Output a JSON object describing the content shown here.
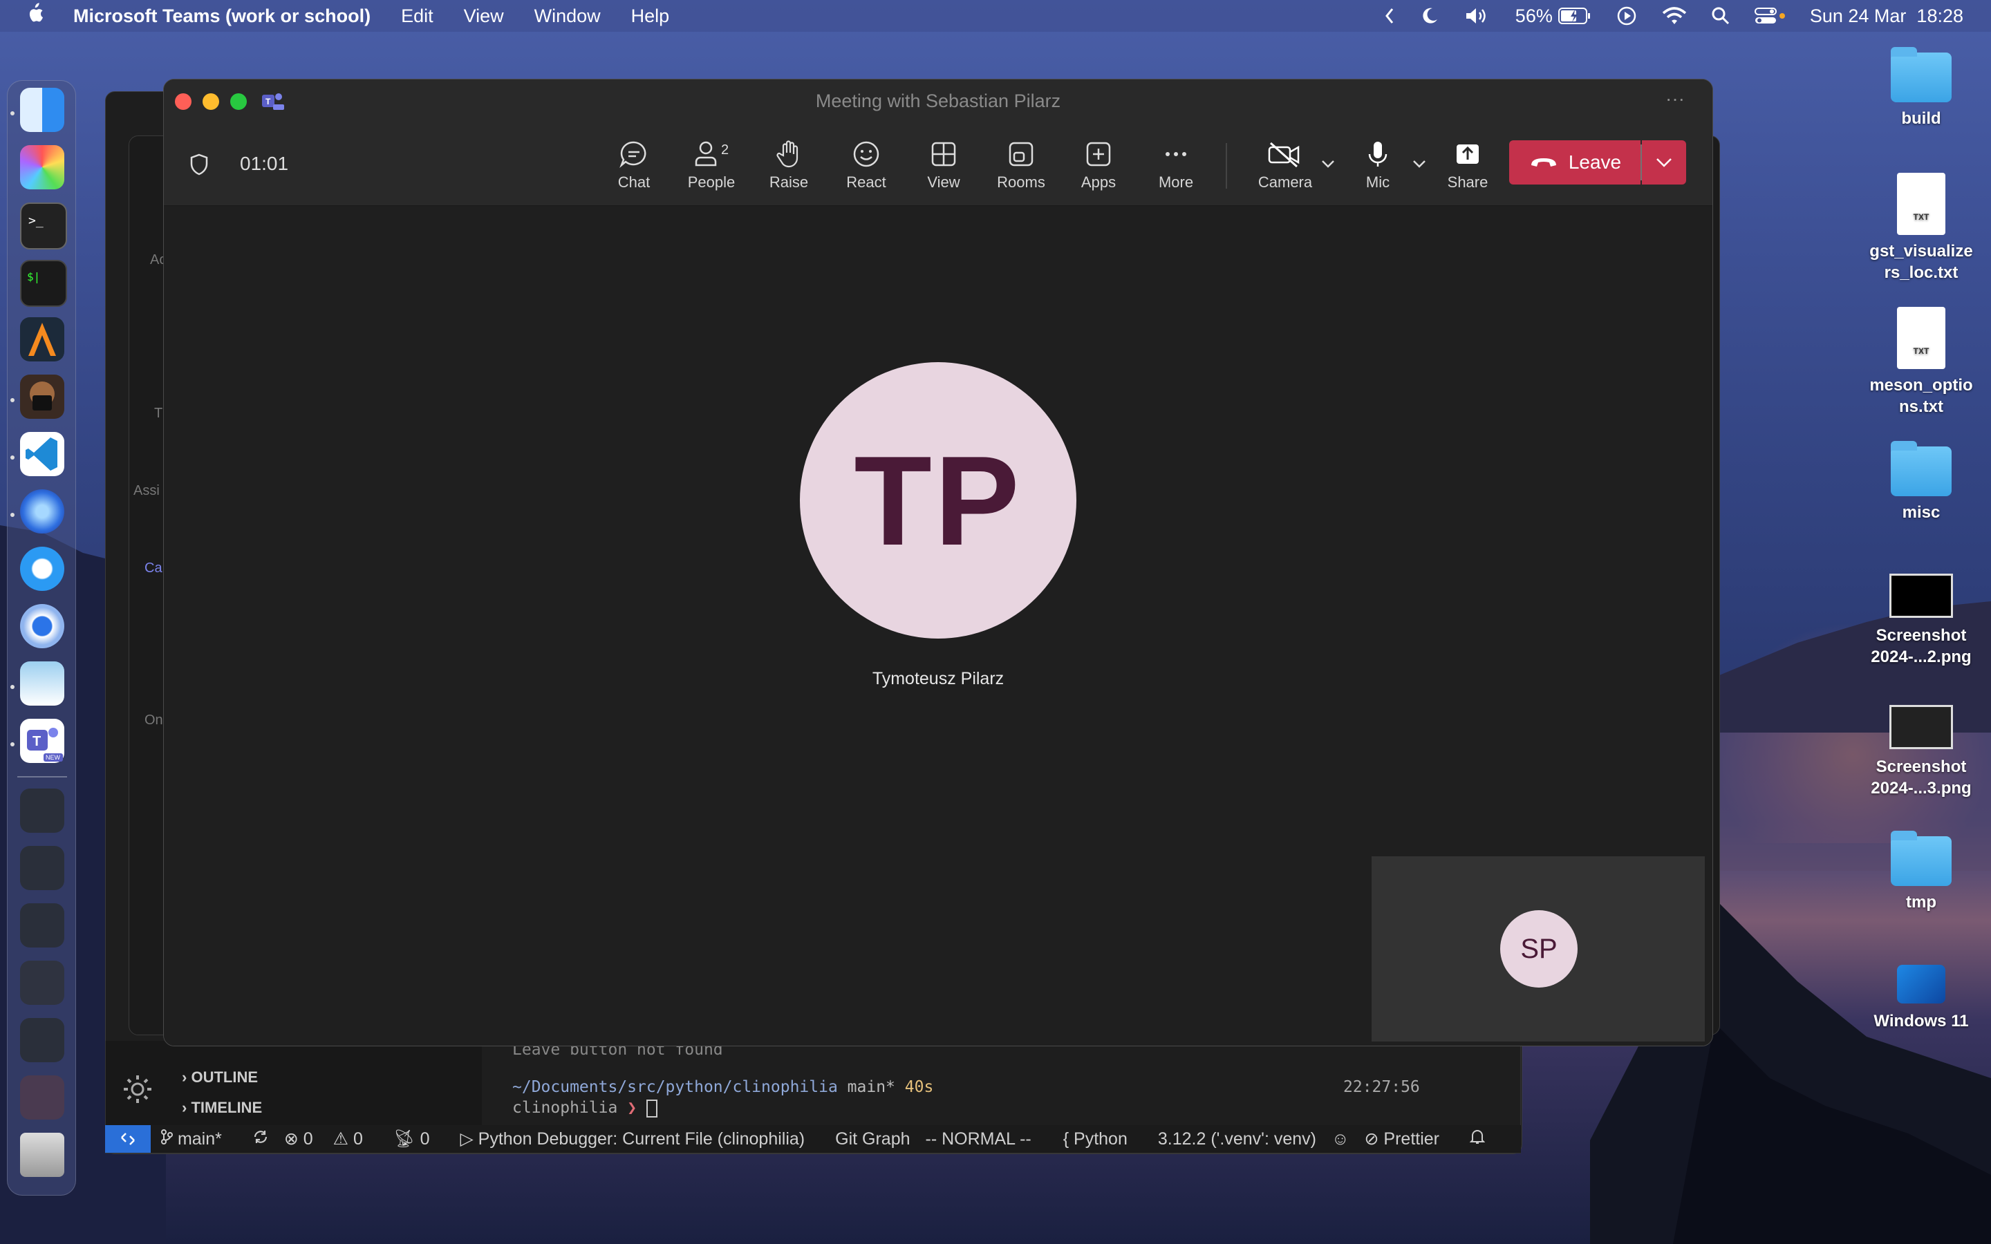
{
  "menubar": {
    "apple_icon": "apple-logo-icon",
    "app_name": "Microsoft Teams (work or school)",
    "menus": [
      "Edit",
      "View",
      "Window",
      "Help"
    ],
    "battery": "56%",
    "datetime": "Sun 24 Mar  18:28"
  },
  "desktop": {
    "items": [
      {
        "label": "build",
        "kind": "folder"
      },
      {
        "label": "gst_visualizers_loc.txt",
        "kind": "txt",
        "badge": "TXT"
      },
      {
        "label": "meson_options.txt",
        "kind": "txt",
        "badge": "TXT"
      },
      {
        "label": "misc",
        "kind": "folder"
      },
      {
        "label": "Screenshot 2024-...2.png",
        "kind": "image"
      },
      {
        "label": "Screenshot 2024-...3.png",
        "kind": "image"
      },
      {
        "label": "tmp",
        "kind": "folder"
      },
      {
        "label": "Windows 11",
        "kind": "app"
      }
    ]
  },
  "teams": {
    "window_title": "Meeting with Sebastian Pilarz",
    "timer": "01:01",
    "more_dots": "···",
    "toolbar": {
      "chat": "Chat",
      "people": "People",
      "people_count": "2",
      "raise": "Raise",
      "react": "React",
      "view": "View",
      "rooms": "Rooms",
      "apps": "Apps",
      "more": "More",
      "camera": "Camera",
      "mic": "Mic",
      "share": "Share",
      "leave": "Leave"
    },
    "participant": {
      "initials": "TP",
      "name": "Tymoteusz Pilarz"
    },
    "self_view": {
      "initials": "SP"
    }
  },
  "vscode": {
    "leave_msg": "Leave button not found",
    "outline": "OUTLINE",
    "timeline": "TIMELINE",
    "prompt_path": "~/Documents/src/python/clinophilia",
    "prompt_branch": "main*",
    "prompt_duration": "40s",
    "prompt_time": "22:27:56",
    "prompt_dir": "clinophilia",
    "prompt_char": "❯",
    "status": {
      "branch": "main*",
      "errors": "0",
      "warnings": "0",
      "ports": "0",
      "debugger": "Python Debugger: Current File (clinophilia)",
      "git_graph": "Git Graph",
      "mode": "-- NORMAL --",
      "language": "Python",
      "interpreter": "3.12.2 ('.venv': venv)",
      "prettier": "Prettier"
    }
  },
  "bg_fragments": [
    "Ac",
    "T",
    "Assi",
    "Ca",
    "On"
  ],
  "colors": {
    "leave": "#c4314b",
    "avatar_bg": "#e8d5e0",
    "avatar_fg": "#4a1a37",
    "teams_bg": "#1f1f1f"
  }
}
